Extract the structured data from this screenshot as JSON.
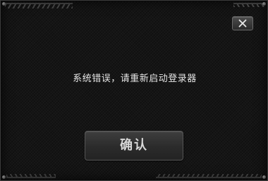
{
  "dialog": {
    "message": "系统错误，请重新启动登录器",
    "confirm_label": "确认",
    "close_icon": "close-icon"
  }
}
